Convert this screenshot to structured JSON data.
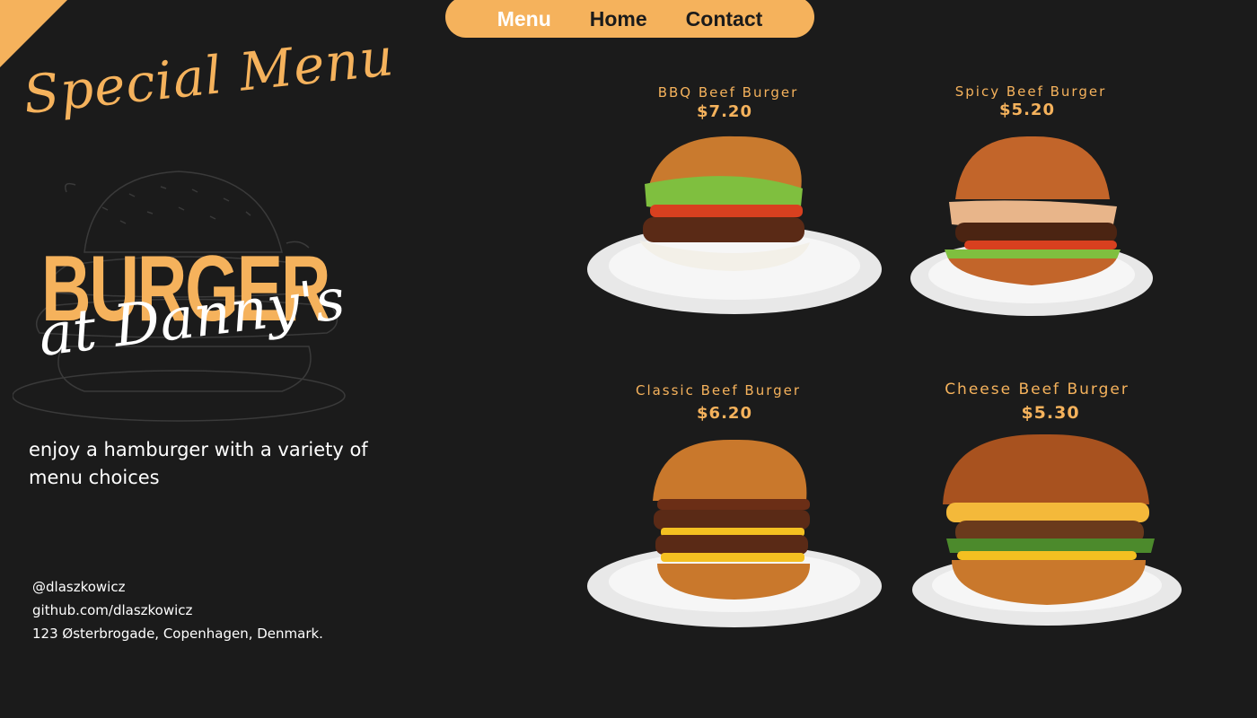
{
  "nav": {
    "items": [
      {
        "label": "Menu",
        "active": true
      },
      {
        "label": "Home",
        "active": false
      },
      {
        "label": "Contact",
        "active": false
      }
    ]
  },
  "hero": {
    "special_label": "Special Menu",
    "title": "BURGER",
    "subtitle": "at Danny's",
    "tagline": "enjoy a hamburger with a variety of menu choices"
  },
  "contacts": {
    "handle": "@dlaszkowicz",
    "github": "github.com/dlaszkowicz",
    "address": "123 Østerbrogade, Copenhagen, Denmark."
  },
  "menu": {
    "items": [
      {
        "name": "BBQ Beef Burger",
        "price": "$7.20"
      },
      {
        "name": "Spicy Beef Burger",
        "price": "$5.20"
      },
      {
        "name": "Classic Beef Burger",
        "price": "$6.20"
      },
      {
        "name": "Cheese Beef Burger",
        "price": "$5.30"
      }
    ]
  },
  "colors": {
    "background": "#1b1b1b",
    "accent": "#f5b25c",
    "text": "#ffffff"
  },
  "icons": [
    "burger-sketch-icon",
    "burger-photo-icon",
    "plate-icon"
  ]
}
